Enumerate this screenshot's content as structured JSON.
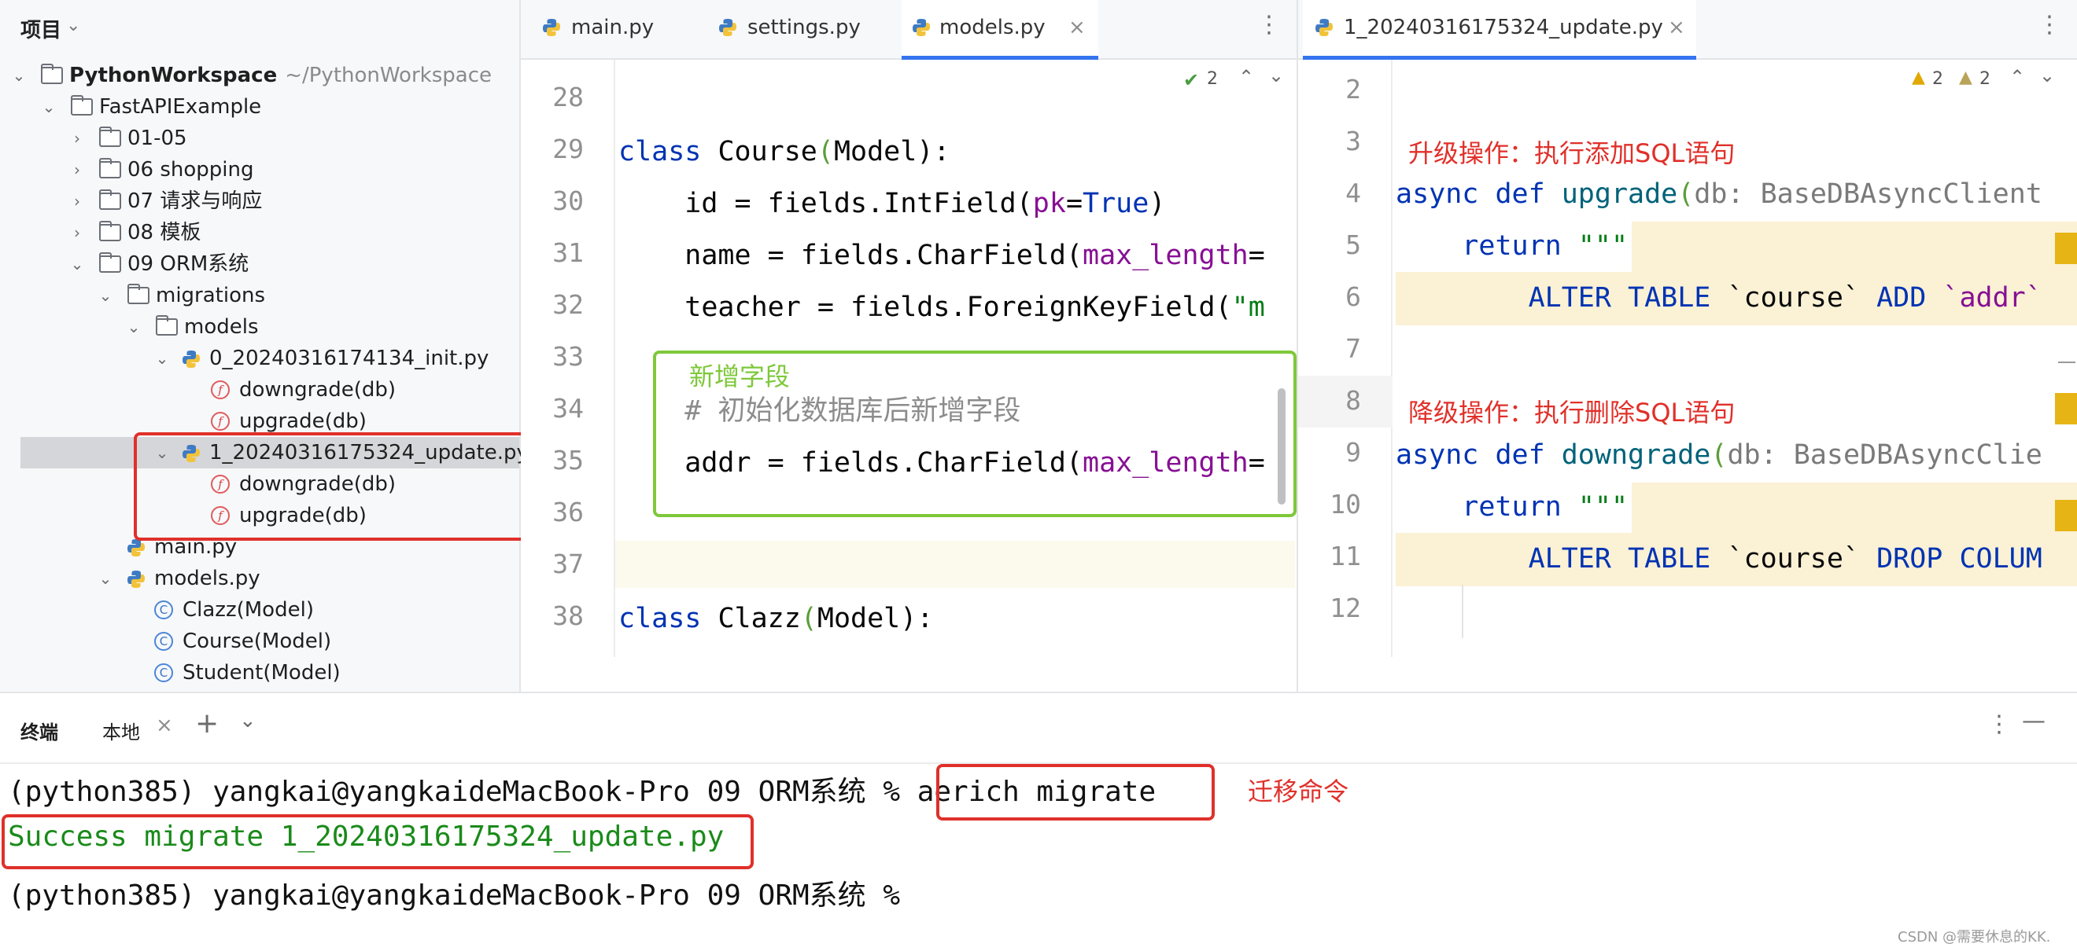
{
  "project_panel": {
    "title": "项目",
    "tree": [
      {
        "label": "PythonWorkspace",
        "path": "~/PythonWorkspace"
      },
      {
        "label": "FastAPIExample"
      },
      {
        "label": "01-05"
      },
      {
        "label": "06 shopping"
      },
      {
        "label": "07 请求与响应"
      },
      {
        "label": "08 模板"
      },
      {
        "label": "09 ORM系统"
      },
      {
        "label": "migrations"
      },
      {
        "label": "models"
      },
      {
        "label": "0_20240316174134_init.py"
      },
      {
        "label": "downgrade(db)"
      },
      {
        "label": "upgrade(db)"
      },
      {
        "label": "1_20240316175324_update.py"
      },
      {
        "label": "downgrade(db)"
      },
      {
        "label": "upgrade(db)"
      },
      {
        "label": "main.py"
      },
      {
        "label": "models.py"
      },
      {
        "label": "Clazz(Model)"
      },
      {
        "label": "Course(Model)"
      },
      {
        "label": "Student(Model)"
      }
    ]
  },
  "left_editor": {
    "tabs": [
      {
        "label": "main.py"
      },
      {
        "label": "settings.py"
      },
      {
        "label": "models.py"
      }
    ],
    "inspection_count": "2",
    "lines": [
      {
        "n": "28"
      },
      {
        "n": "29"
      },
      {
        "n": "30"
      },
      {
        "n": "31"
      },
      {
        "n": "32"
      },
      {
        "n": "33"
      },
      {
        "n": "34"
      },
      {
        "n": "35"
      },
      {
        "n": "36"
      },
      {
        "n": "37"
      },
      {
        "n": "38"
      }
    ],
    "code": {
      "l29_kw": "class",
      "l29_name": "Course",
      "l29_paren_open": "(",
      "l29_base": "Model",
      "l29_rest": "):",
      "l30_a": "    id = fields.IntField(",
      "l30_p": "pk",
      "l30_eq": "=",
      "l30_v": "True",
      "l30_end": ")",
      "l31_a": "    name = fields.CharField(",
      "l31_p": "max_length",
      "l31_eq": "=",
      "l32_a": "    teacher = fields.ForeignKeyField(",
      "l32_s": "\"m",
      "l34_cmt": "    # 初始化数据库后新增字段",
      "l35_a": "    addr = fields.CharField(",
      "l35_p": "max_length",
      "l35_eq": "=",
      "l38_kw": "class",
      "l38_name": "Clazz",
      "l38_paren_open": "(",
      "l38_base": "Model",
      "l38_rest": "):"
    },
    "annotation": "新增字段"
  },
  "right_editor": {
    "tab": {
      "label": "1_20240316175324_update.py"
    },
    "warnings_a": "2",
    "warnings_b": "2",
    "lines": [
      {
        "n": "2"
      },
      {
        "n": "3"
      },
      {
        "n": "4"
      },
      {
        "n": "5"
      },
      {
        "n": "6"
      },
      {
        "n": "7"
      },
      {
        "n": "8"
      },
      {
        "n": "9"
      },
      {
        "n": "10"
      },
      {
        "n": "11"
      },
      {
        "n": "12"
      }
    ],
    "code": {
      "l4_kw1": "async",
      "l4_kw2": "def",
      "l4_fn": "upgrade",
      "l4_po": "(",
      "l4_p": "db: BaseDBAsyncClient",
      "l5_kw": "return",
      "l5_s": "\"\"\"",
      "l6_sql1": "ALTER TABLE",
      "l6_s1": " `course` ",
      "l6_sql2": "ADD",
      "l6_s2": " `addr`",
      "l9_kw1": "async",
      "l9_kw2": "def",
      "l9_fn": "downgrade",
      "l9_po": "(",
      "l9_p": "db: BaseDBAsyncClie",
      "l10_kw": "return",
      "l10_s": "\"\"\"",
      "l11_sql1": "ALTER TABLE",
      "l11_s1": " `course` ",
      "l11_sql2": "DROP COLUM"
    },
    "note_upgrade": "升级操作：执行添加SQL语句",
    "note_downgrade": "降级操作：执行删除SQL语句"
  },
  "terminal": {
    "title": "终端",
    "tab": "本地",
    "prompt1": "(python385) yangkai@yangkaideMacBook-Pro 09 ORM系统 % ",
    "command": "aerich migrate",
    "command_note": "迁移命令",
    "output": "Success migrate 1_20240316175324_update.py",
    "prompt2": "(python385) yangkai@yangkaideMacBook-Pro 09 ORM系统 %"
  },
  "watermark": "CSDN @需要休息的KK.",
  "colors": {
    "highlight_red": "#e0302a",
    "highlight_green": "#7ec83a",
    "keyword": "#0033b3",
    "string_green": "#067d17",
    "accent_blue": "#3574f0"
  }
}
